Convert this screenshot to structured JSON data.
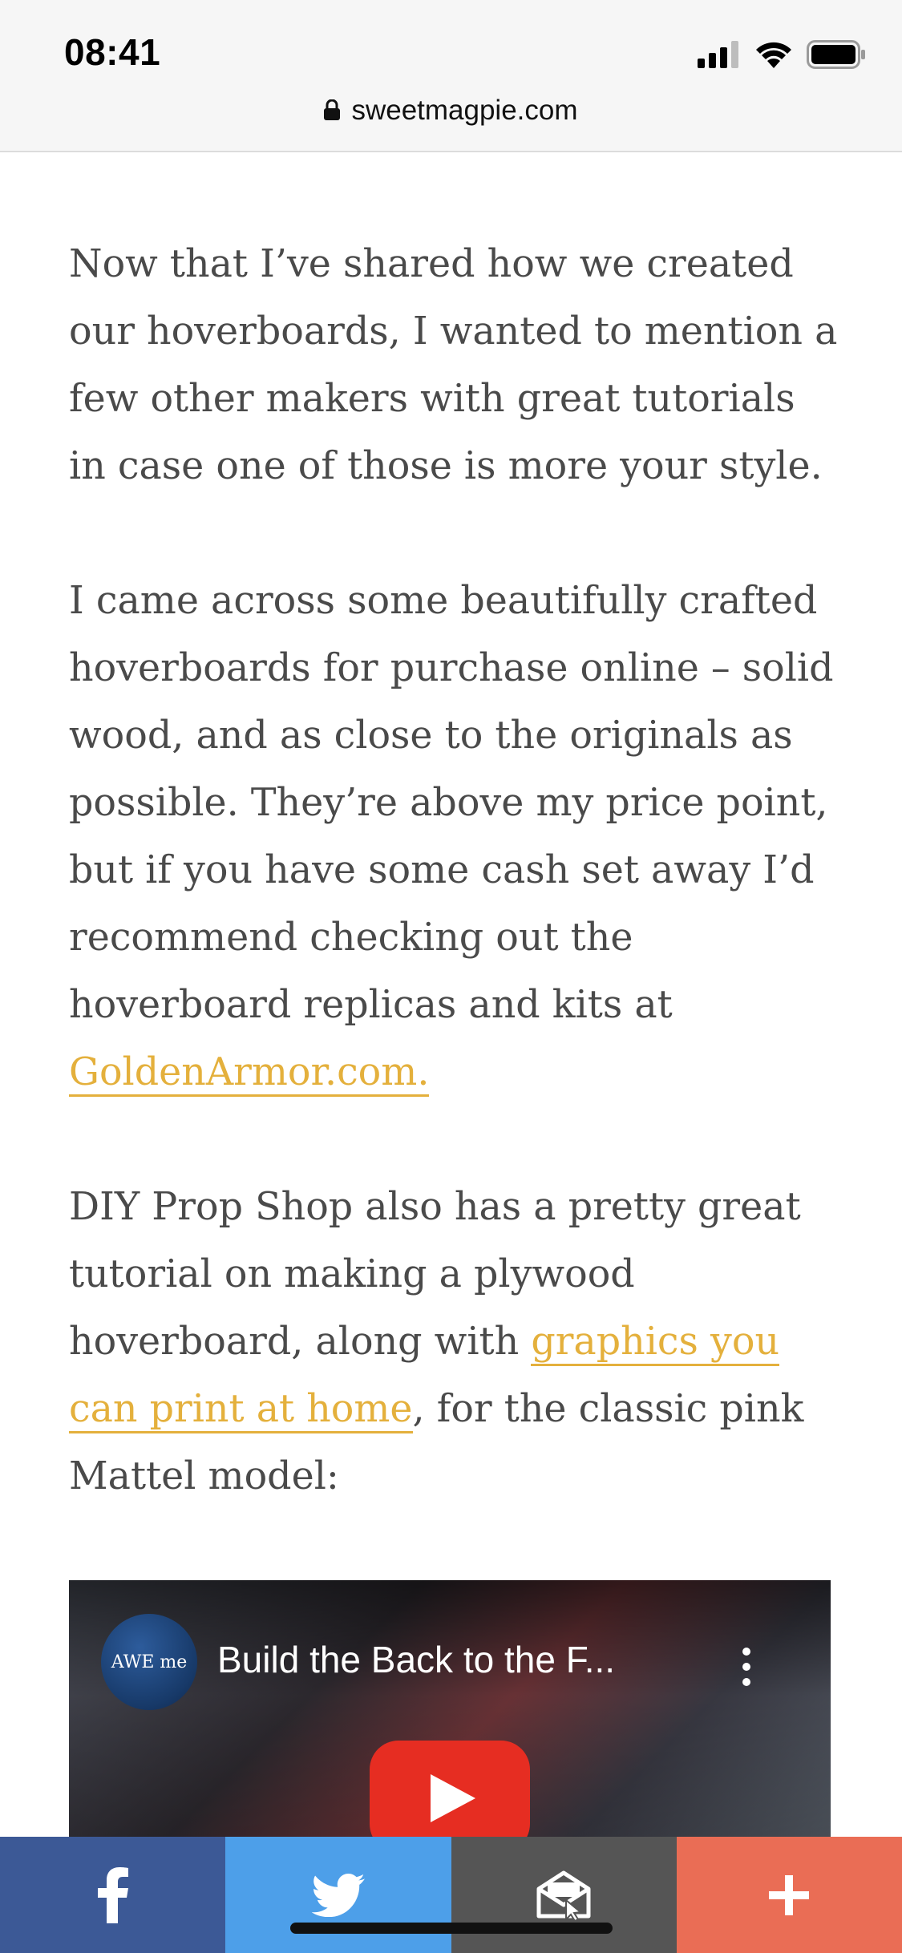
{
  "status_bar": {
    "time": "08:41"
  },
  "url_bar": {
    "domain": "sweetmagpie.com"
  },
  "article": {
    "p1": "Now that I’ve shared how we created our hoverboards, I wanted to mention a few other makers with great tutorials in case one of those is more your style.",
    "p2_text": "I came across some beautifully crafted hoverboards for purchase online – solid wood, and as close to the originals as possible. They’re above my price point, but if you have some cash set away I’d recommend checking out the hoverboard replicas and kits at ",
    "p2_link": "GoldenArmor.com.",
    "p3_text_before": "DIY Prop Shop also has a pretty great tutorial on making a plywood hoverboard, along with ",
    "p3_link": "graphics you can print at home",
    "p3_text_after": ", for the classic pink Mattel model:"
  },
  "video": {
    "title": "Build the Back to the F...",
    "channel_logo_text": "AWE me"
  },
  "share_bar": {
    "buttons": [
      {
        "name": "facebook",
        "icon": "facebook-icon",
        "color": "#3c5996"
      },
      {
        "name": "twitter",
        "icon": "twitter-icon",
        "color": "#4d9fe9"
      },
      {
        "name": "email",
        "icon": "email-icon",
        "color": "#555555"
      },
      {
        "name": "more",
        "icon": "plus-icon",
        "color": "#ea6d55"
      }
    ]
  },
  "colors": {
    "link": "#e4b03c",
    "body_text": "#4a4a4a"
  }
}
